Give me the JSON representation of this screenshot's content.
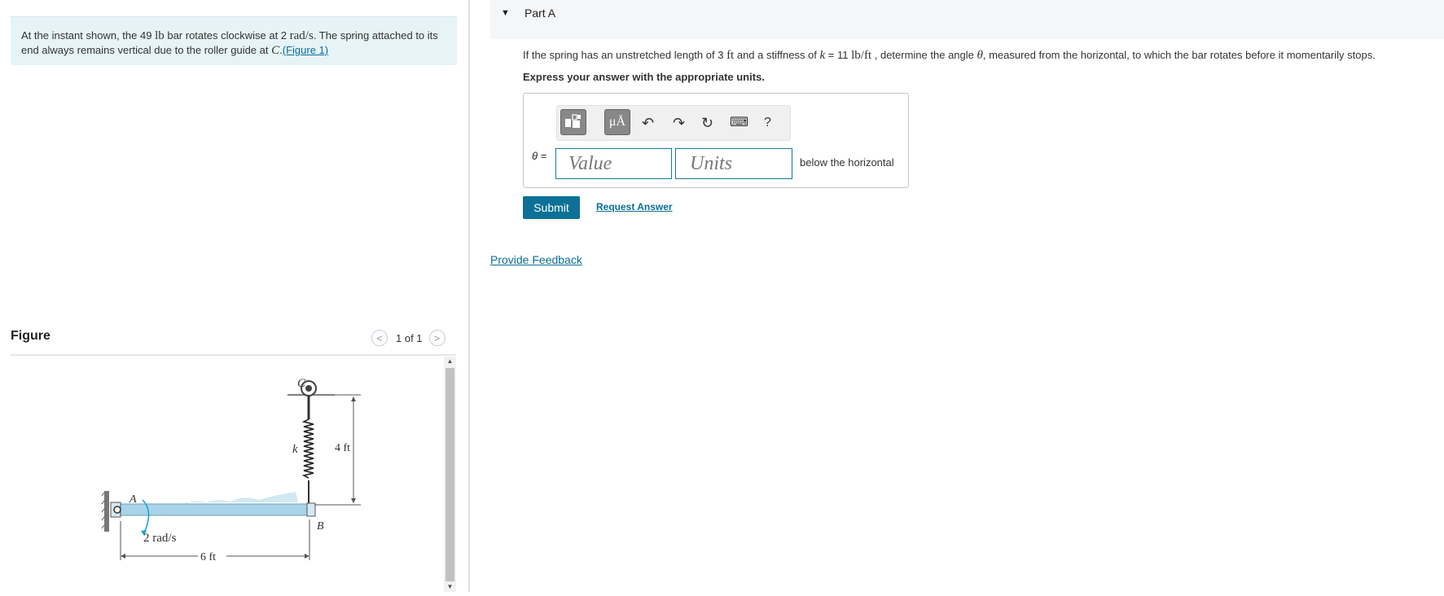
{
  "problem": {
    "text_1": "At the instant shown, the 49 ",
    "unit_lb": "lb",
    "text_2": " bar rotates clockwise at 2 ",
    "unit_rad": "rad/s",
    "text_3": ". The spring attached to its end always remains vertical due to the roller guide at ",
    "point_c": "C",
    "text_4": ".",
    "figure_link": "(Figure 1)"
  },
  "figure": {
    "title": "Figure",
    "nav_prev": "<",
    "nav_next": ">",
    "page_indicator": "1 of 1",
    "labels": {
      "c": "C",
      "a": "A",
      "b": "B",
      "k": "k",
      "height": "4 ft",
      "length": "6 ft",
      "omega": "2 rad/s"
    }
  },
  "part": {
    "caret": "▼",
    "title": "Part A",
    "question_1": "If the spring has an unstretched length of 3 ",
    "unit_ft": "ft",
    "question_2": " and a stiffness of ",
    "k_sym": "k",
    "question_3": " = 11 ",
    "unit_lbft": "lb/ft",
    "question_4": " , determine the angle ",
    "theta_sym": "θ",
    "question_5": ", measured from the horizontal, to which the bar rotates before it momentarily stops.",
    "instruction": "Express your answer with the appropriate units.",
    "theta_label": "θ =",
    "value_placeholder": "Value",
    "units_placeholder": "Units",
    "after_text": "below the horizontal",
    "toolbar": {
      "mu_label": "μÅ",
      "undo": "↶",
      "redo": "↷",
      "reset": "↻",
      "keyboard": "⌨",
      "help": "?"
    },
    "submit_label": "Submit",
    "request_label": "Request Answer"
  },
  "feedback_label": "Provide Feedback",
  "colors": {
    "accent": "#0d7096",
    "link": "#0b6d96",
    "problem_bg": "#e6f4f7",
    "bar": "#a9d3e8"
  }
}
